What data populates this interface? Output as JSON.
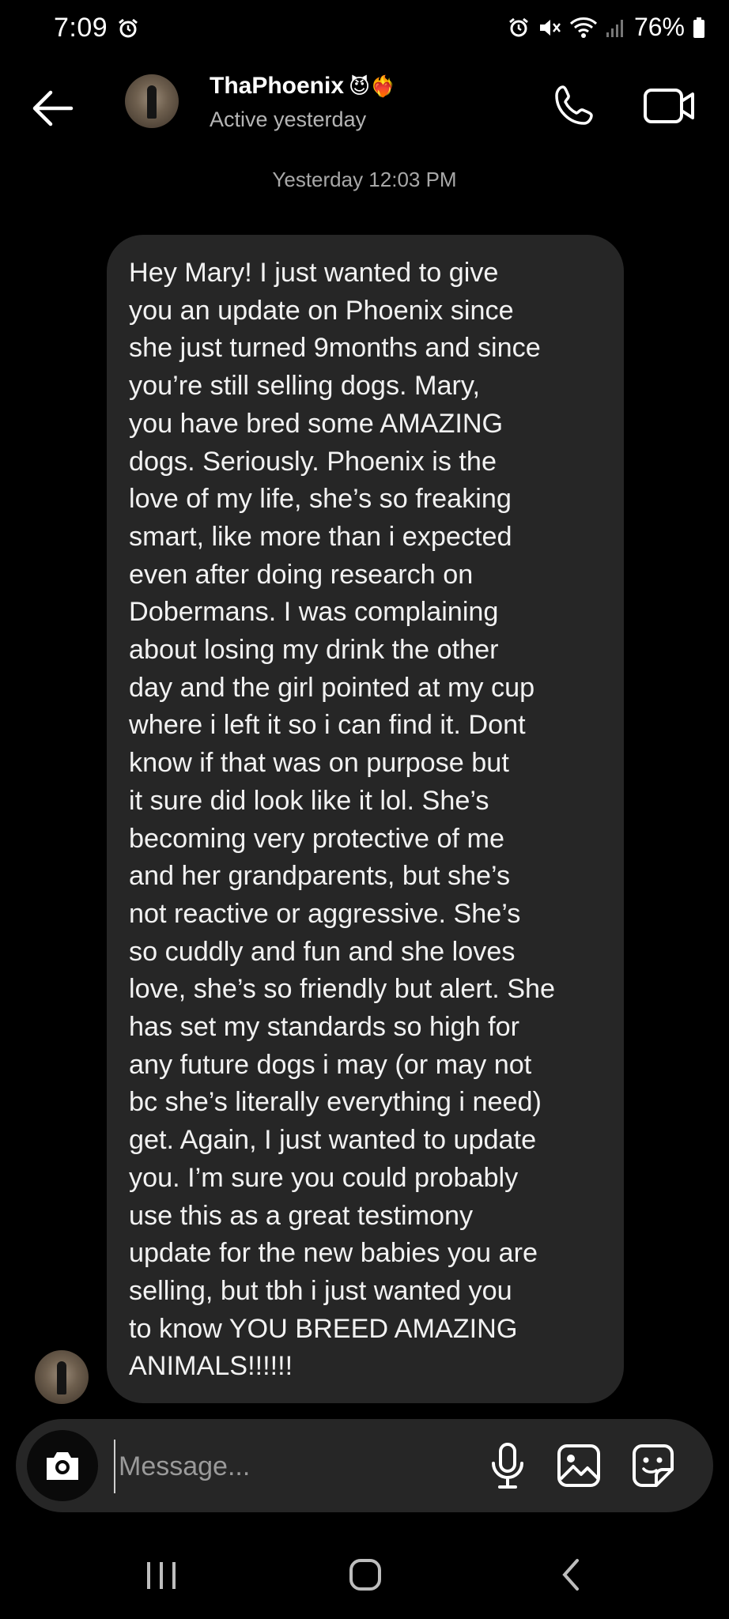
{
  "status_bar": {
    "time": "7:09",
    "battery": "76%"
  },
  "header": {
    "contact_name": "ThaPhoenix",
    "name_emojis": "😈❤️‍🔥",
    "active_status": "Active yesterday"
  },
  "thread": {
    "timestamp": "Yesterday 12:03 PM",
    "message": "Hey Mary! I just wanted to give\nyou an update on Phoenix since\nshe just turned 9months and since\nyou’re still selling dogs. Mary,\nyou have bred some AMAZING\ndogs. Seriously. Phoenix is the\nlove of my life, she’s so freaking\nsmart, like more than i expected\neven after doing research on\nDobermans. I was complaining\nabout losing my drink the other\nday and the girl pointed at my cup\nwhere i left it so i can find it. Dont\nknow if that was on purpose but\nit sure did look like it lol. She’s\nbecoming very protective of me\nand her grandparents, but she’s\nnot reactive or aggressive. She’s\nso cuddly and fun and she loves\nlove, she’s so friendly but alert. She\nhas set my standards so high for\nany future dogs i may (or may not\nbc she’s literally everything i need)\nget. Again, I just wanted to update\nyou. I’m sure you could probably\nuse this as a great testimony\nupdate for the new babies you are\nselling, but tbh i just wanted you\nto know YOU BREED AMAZING\nANIMALS!!!!!!"
  },
  "composer": {
    "placeholder": "Message..."
  },
  "colors": {
    "background": "#000000",
    "bubble": "#262626",
    "composer": "#262626",
    "secondary_text": "#a8a8a8"
  },
  "icons": {
    "status_left": "alarm-icon",
    "status_right": [
      "alarm-icon",
      "mute-icon",
      "wifi-icon",
      "signal-icon",
      "battery-icon"
    ],
    "header": [
      "back-arrow-icon",
      "phone-icon",
      "video-icon"
    ],
    "composer": [
      "camera-icon",
      "mic-icon",
      "gallery-icon",
      "sticker-icon"
    ],
    "nav": [
      "recents-icon",
      "home-icon",
      "back-icon"
    ]
  }
}
